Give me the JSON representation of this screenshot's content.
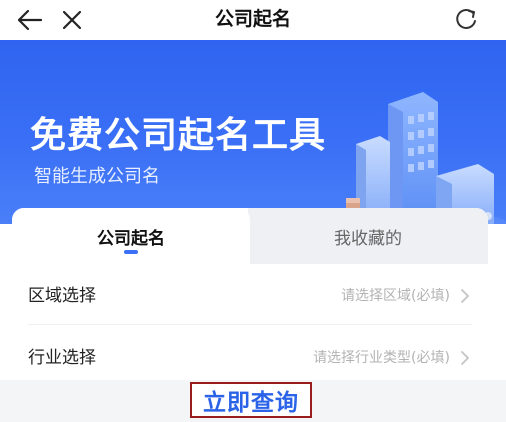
{
  "header": {
    "title": "公司起名",
    "back_icon": "arrow-left-icon",
    "close_icon": "close-icon",
    "refresh_icon": "refresh-icon"
  },
  "banner": {
    "heading": "免费公司起名工具",
    "subheading": "智能生成公司名",
    "bg_color": "#3a6ff6"
  },
  "tabs": [
    {
      "label": "公司起名",
      "active": true
    },
    {
      "label": "我收藏的",
      "active": false
    }
  ],
  "form": {
    "rows": [
      {
        "label": "区域选择",
        "placeholder": "请选择区域(必填)"
      },
      {
        "label": "行业选择",
        "placeholder": "请选择行业类型(必填)"
      }
    ]
  },
  "actions": {
    "query_label": "立即查询",
    "query_color": "#2b63e8"
  }
}
